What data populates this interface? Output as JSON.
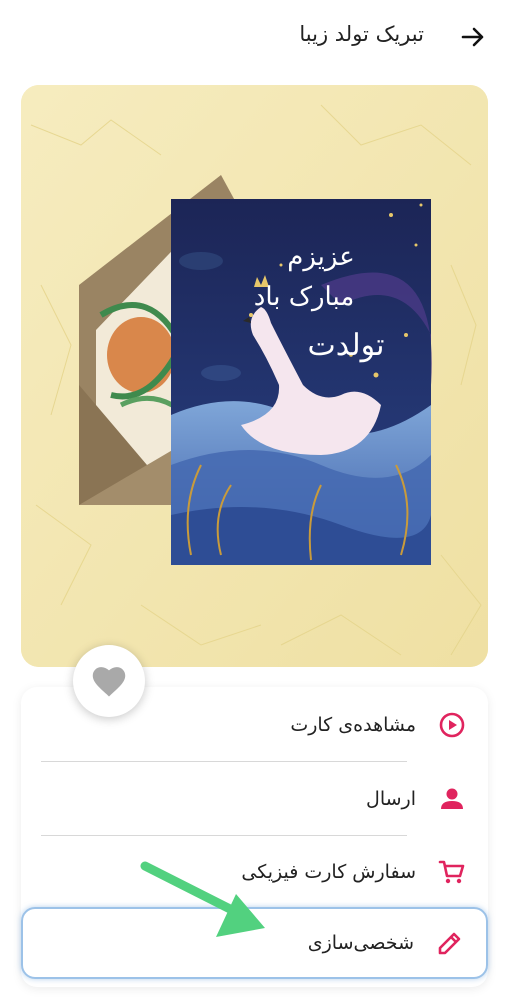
{
  "header": {
    "title": "تبریک تولد زیبا",
    "back_icon": "arrow-right-icon"
  },
  "card": {
    "text_line1": "عزیزم",
    "text_line2": "مبارک باد",
    "text_line3": "تولدت"
  },
  "favorite": {
    "icon": "heart-icon"
  },
  "menu": {
    "items": [
      {
        "label": "مشاهده‌ی کارت",
        "icon": "play-circle-icon"
      },
      {
        "label": "ارسال",
        "icon": "person-icon"
      },
      {
        "label": "سفارش کارت فیزیکی",
        "icon": "cart-icon"
      },
      {
        "label": "شخصی‌سازی",
        "icon": "pencil-icon"
      }
    ]
  },
  "colors": {
    "accent": "#e0245e",
    "highlight_arrow": "#52d17f",
    "background": "#f3e7b2",
    "card_navy": "#1f2b5e"
  }
}
